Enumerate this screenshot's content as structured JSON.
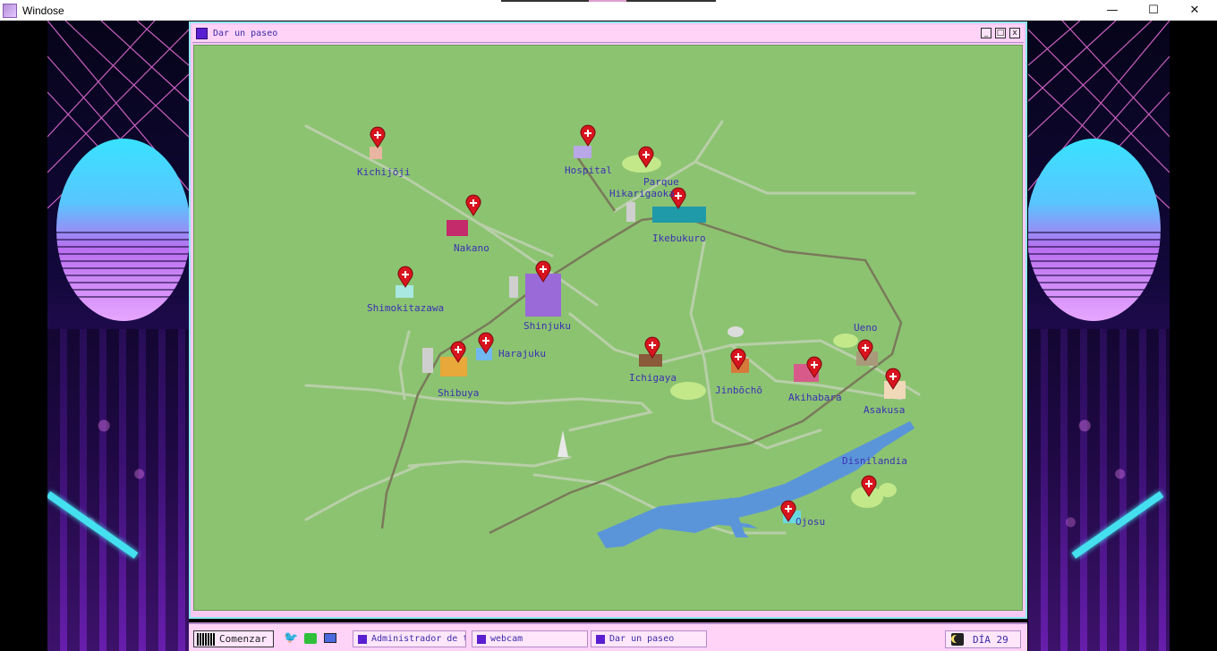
{
  "os_window": {
    "title": "Windose",
    "controls": [
      "—",
      "☐",
      "✕"
    ]
  },
  "app_window": {
    "title": "Dar un paseo",
    "buttons": [
      "_",
      "□",
      "x"
    ]
  },
  "map": {
    "locations": [
      {
        "name": "Kichijōji",
        "color": "#e8b6a0"
      },
      {
        "name": "Hospital",
        "color": "#b9a7e8"
      },
      {
        "name": "Parque Hikarigaoka",
        "color": "#b8e086"
      },
      {
        "name": "Nakano",
        "color": "#c42b6a"
      },
      {
        "name": "Ikebukuro",
        "color": "#1f9aa8"
      },
      {
        "name": "Shimokitazawa",
        "color": "#a8e8e0"
      },
      {
        "name": "Shinjuku",
        "color": "#9a6ad8"
      },
      {
        "name": "Harajuku",
        "color": "#6fb8f0"
      },
      {
        "name": "Shibuya",
        "color": "#e8a83a"
      },
      {
        "name": "Ichigaya",
        "color": "#8a5a3a"
      },
      {
        "name": "Jinbōchō",
        "color": "#d8783a"
      },
      {
        "name": "Akihabara",
        "color": "#d85a8a"
      },
      {
        "name": "Ueno",
        "color": "#a89a7a"
      },
      {
        "name": "Asakusa",
        "color": "#f0d8b8"
      },
      {
        "name": "Disnilandia",
        "color": "#c8f08a"
      },
      {
        "name": "Ojosu",
        "color": "#6ad8e0"
      }
    ]
  },
  "taskbar": {
    "start_label": "Comenzar",
    "quick_icons": [
      "twitter-icon",
      "chat-icon",
      "monitor-icon"
    ],
    "tasks": [
      "Administrador de tar...",
      "webcam",
      "Dar un paseo"
    ],
    "clock_label": "DÍA 29"
  }
}
